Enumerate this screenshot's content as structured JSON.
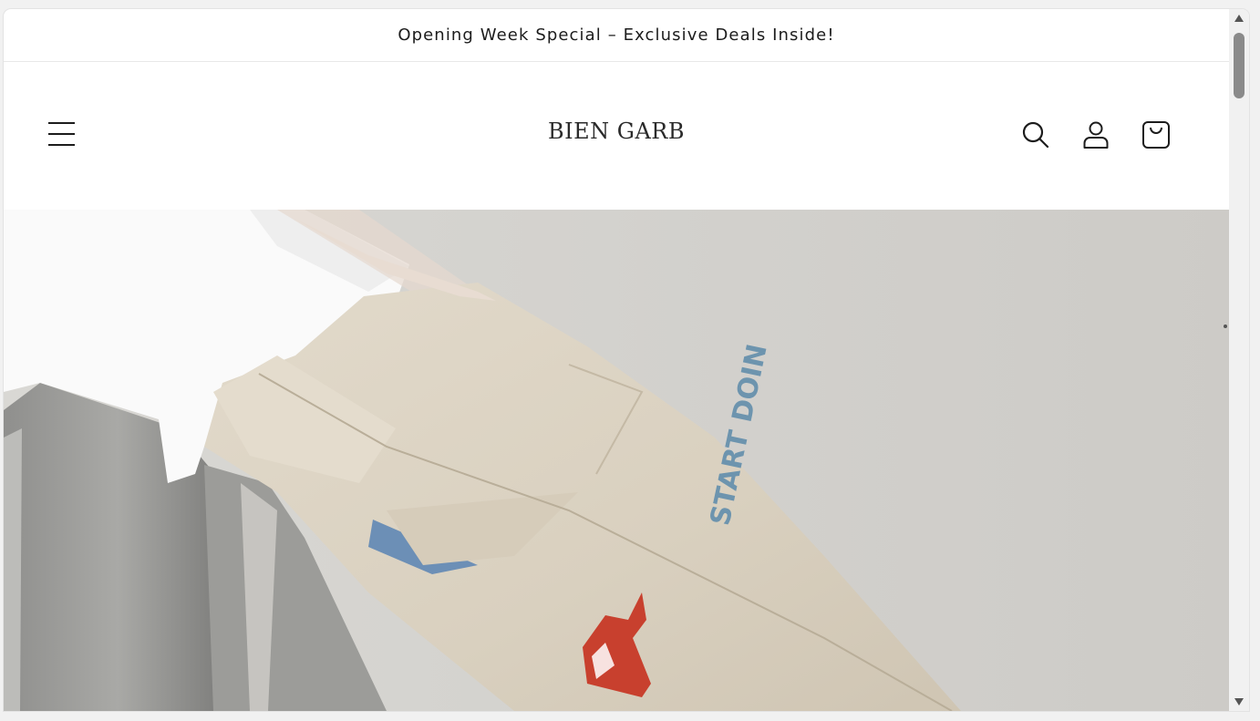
{
  "announcement": {
    "text": "Opening Week Special – Exclusive Deals Inside!"
  },
  "header": {
    "logo": "BIEN GARB",
    "icons": [
      "menu-icon",
      "search-icon",
      "account-icon",
      "cart-icon"
    ]
  },
  "hero": {
    "graphic_text": "START DOIN",
    "colors": {
      "background": "#d2d1cd",
      "pants": "#ddd4c3",
      "shirt": "#ffffff",
      "print_blue": "#6d94ae",
      "print_red": "#c8402e"
    }
  }
}
